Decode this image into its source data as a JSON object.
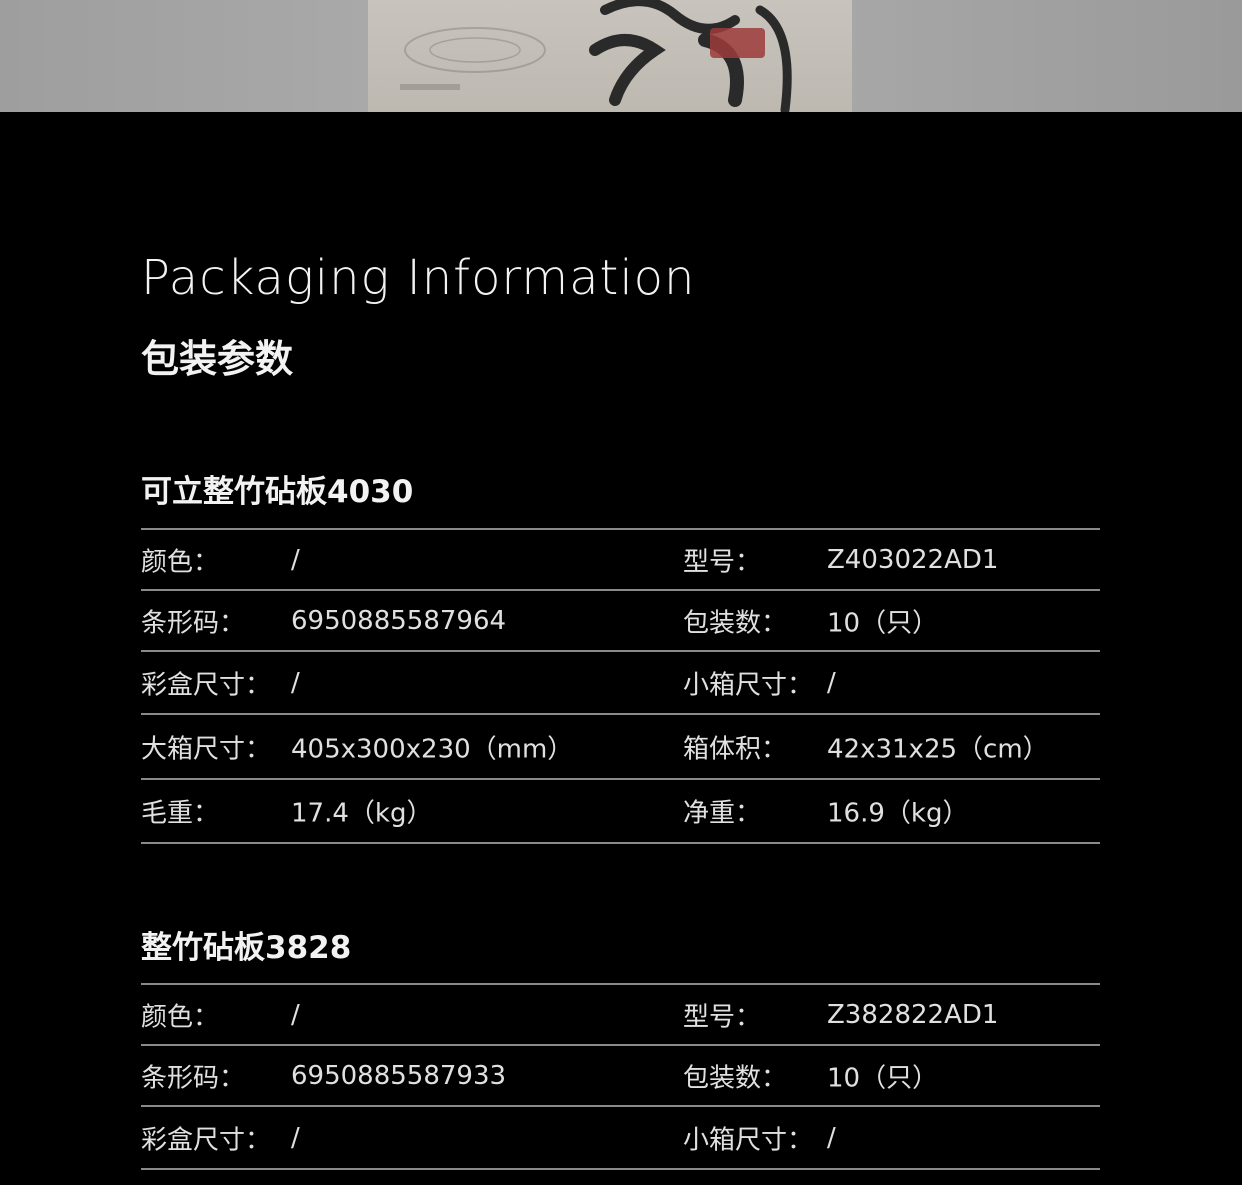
{
  "page": {
    "title": "Packaging Information",
    "subtitle": "包装参数"
  },
  "sections": [
    {
      "name": "可立整竹砧板4030",
      "rows": [
        {
          "l1": "颜色：",
          "v1": "/",
          "l2": "型号：",
          "v2": "Z403022AD1"
        },
        {
          "l1": "条形码：",
          "v1": "6950885587964",
          "l2": "包装数：",
          "v2": "10（只）"
        },
        {
          "l1": "彩盒尺寸：",
          "v1": "/",
          "l2": "小箱尺寸：",
          "v2": "/"
        },
        {
          "l1": "大箱尺寸：",
          "v1": "405x300x230（mm）",
          "l2": "箱体积：",
          "v2": "42x31x25（cm）"
        },
        {
          "l1": "毛重：",
          "v1": "17.4（kg）",
          "l2": "净重：",
          "v2": "16.9（kg）"
        }
      ]
    },
    {
      "name": "整竹砧板3828",
      "rows": [
        {
          "l1": "颜色：",
          "v1": "/",
          "l2": "型号：",
          "v2": "Z382822AD1"
        },
        {
          "l1": "条形码：",
          "v1": "6950885587933",
          "l2": "包装数：",
          "v2": "10（只）"
        },
        {
          "l1": "彩盒尺寸：",
          "v1": "/",
          "l2": "小箱尺寸：",
          "v2": "/"
        }
      ]
    }
  ]
}
